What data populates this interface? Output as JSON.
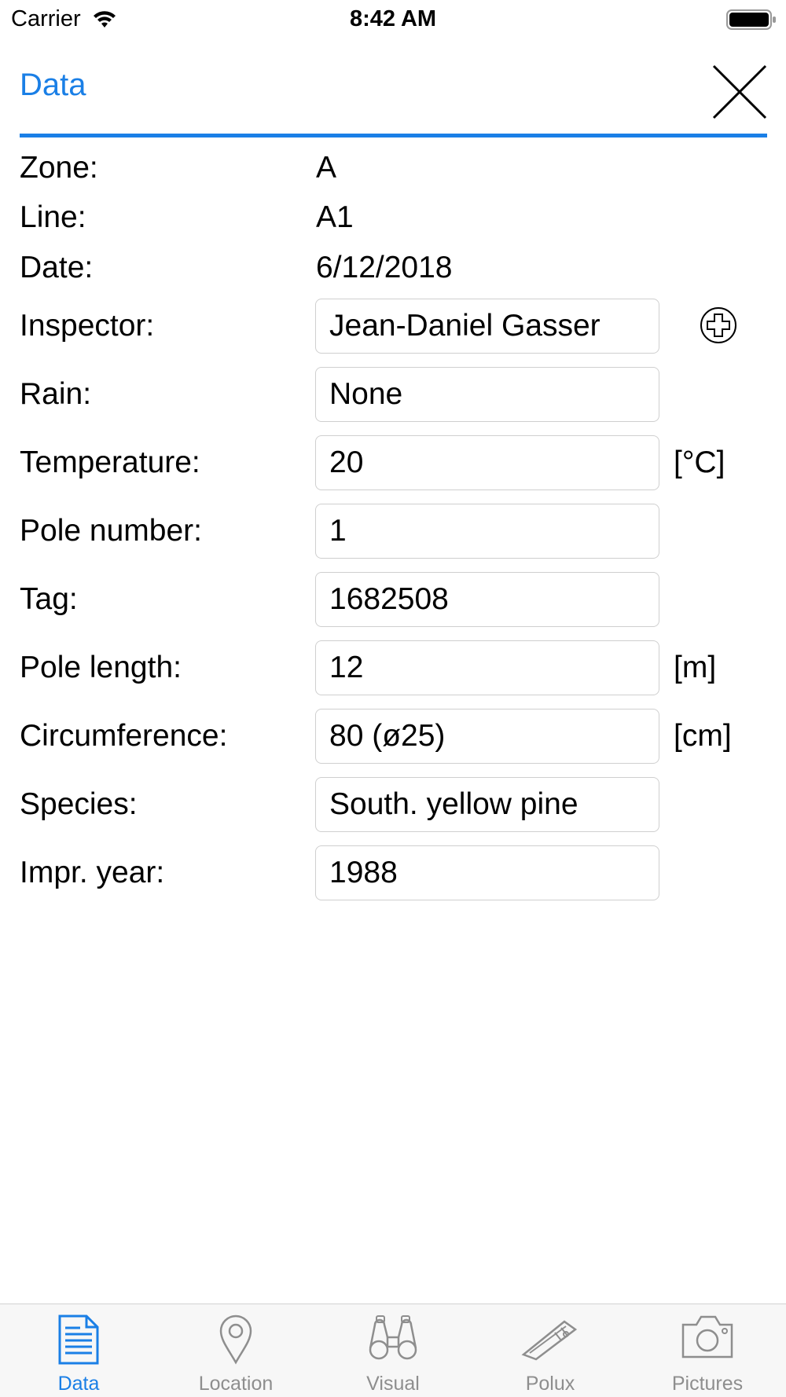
{
  "status_bar": {
    "carrier": "Carrier",
    "time": "8:42 AM"
  },
  "header": {
    "title": "Data",
    "close_icon": "close-icon"
  },
  "info": {
    "zone_label": "Zone:",
    "zone_value": "A",
    "line_label": "Line:",
    "line_value": "A1",
    "date_label": "Date:",
    "date_value": "6/12/2018"
  },
  "form": {
    "inspector_label": "Inspector:",
    "inspector_value": "Jean-Daniel Gasser",
    "rain_label": "Rain:",
    "rain_value": "None",
    "temperature_label": "Temperature:",
    "temperature_value": "20",
    "temperature_unit": "[°C]",
    "pole_number_label": "Pole number:",
    "pole_number_value": "1",
    "tag_label": "Tag:",
    "tag_value": "1682508",
    "pole_length_label": "Pole length:",
    "pole_length_value": "12",
    "pole_length_unit": "[m]",
    "circumference_label": "Circumference:",
    "circumference_value": "80 (ø25)",
    "circumference_unit": "[cm]",
    "species_label": "Species:",
    "species_value": "South. yellow pine",
    "impr_year_label": "Impr. year:",
    "impr_year_value": "1988"
  },
  "tabs": [
    {
      "label": "Data",
      "icon": "document-icon",
      "active": true
    },
    {
      "label": "Location",
      "icon": "location-pin-icon",
      "active": false
    },
    {
      "label": "Visual",
      "icon": "binoculars-icon",
      "active": false
    },
    {
      "label": "Polux",
      "icon": "polux-device-icon",
      "active": false
    },
    {
      "label": "Pictures",
      "icon": "camera-icon",
      "active": false
    }
  ],
  "colors": {
    "accent": "#1a7fe6",
    "inactive": "#8e8e8e",
    "field_border": "#cfcfcf"
  }
}
